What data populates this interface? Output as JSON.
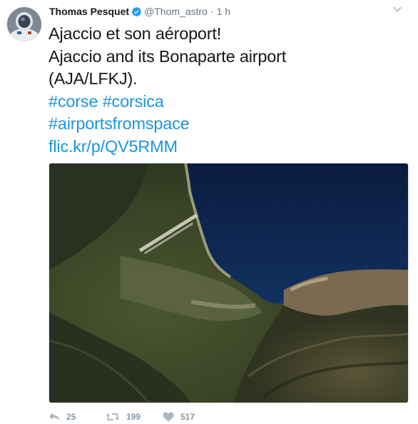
{
  "tweet": {
    "author": {
      "display_name": "Thomas Pesquet",
      "handle": "@Thom_astro",
      "verified": true,
      "avatar_icon": "astronaut-avatar"
    },
    "separator": "·",
    "timestamp": "1 h",
    "text_lines": [
      "Ajaccio et son aéroport!",
      "Ajaccio and its Bonaparte airport",
      "(AJA/LFKJ)."
    ],
    "hashtags_line": [
      "#corse",
      "#corsica"
    ],
    "hashtag_airports": "#airportsfromspace",
    "link": "flic.kr/p/QV5RMM",
    "actions": {
      "replies": "25",
      "retweets": "199",
      "likes": "517"
    },
    "icons": {
      "verified": "verified-badge-icon",
      "menu": "chevron-down-icon",
      "reply": "reply-icon",
      "retweet": "retweet-icon",
      "like": "heart-icon"
    },
    "colors": {
      "link": "#1b95e0",
      "verified": "#1da1f2",
      "muted": "#657786",
      "action": "#aab8c2"
    }
  }
}
